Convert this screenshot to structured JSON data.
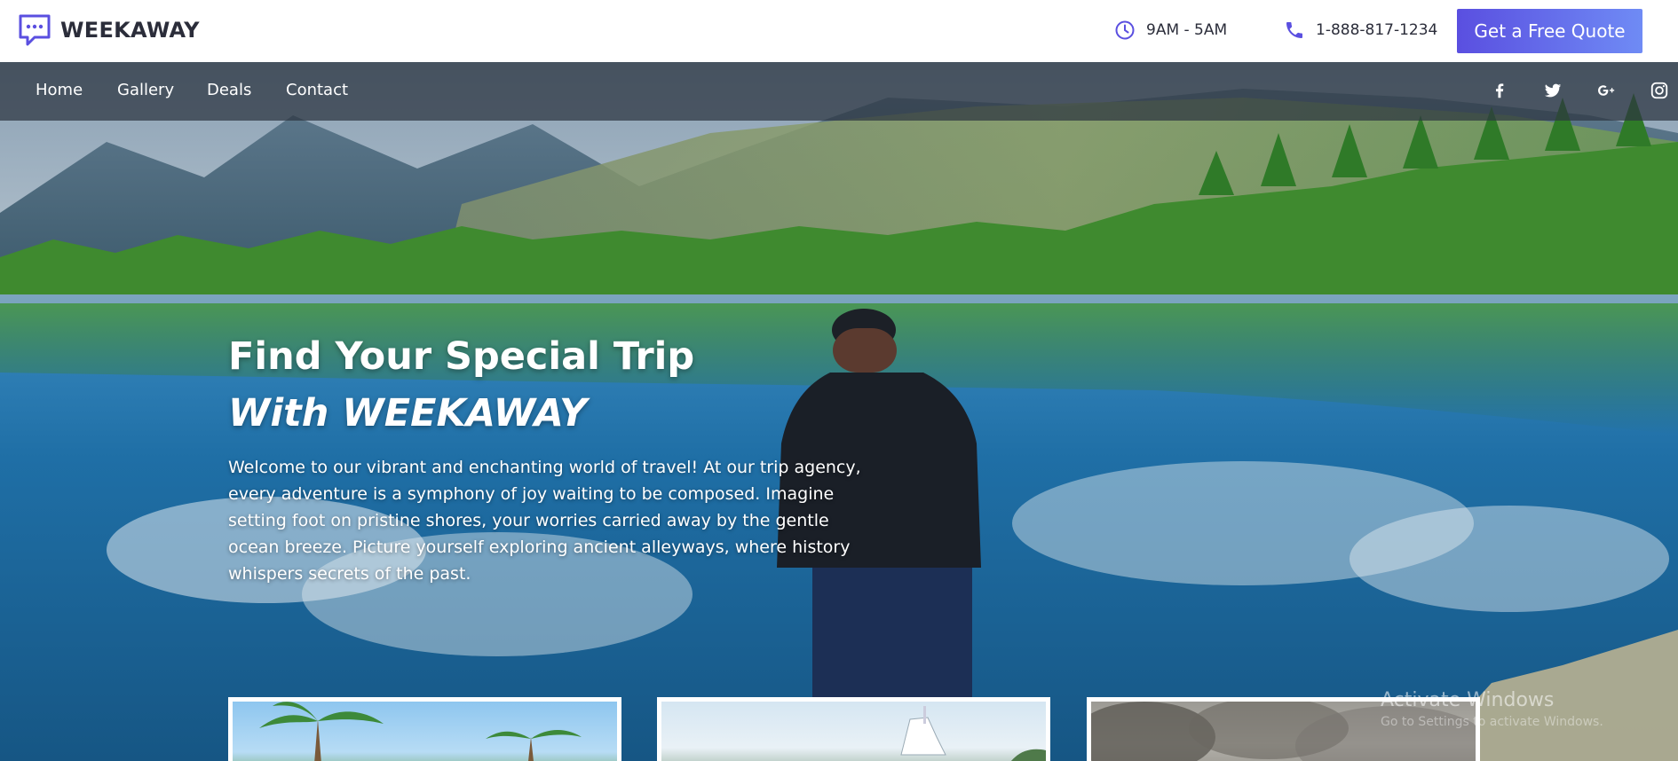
{
  "brand": {
    "name": "WEEKAWAY",
    "icon": "chat-bubble-icon"
  },
  "header": {
    "hours": {
      "icon": "clock-icon",
      "text": "9AM - 5AM"
    },
    "phone": {
      "icon": "phone-icon",
      "text": "1-888-817-1234"
    },
    "cta_label": "Get a Free Quote"
  },
  "nav": {
    "items": [
      {
        "label": "Home"
      },
      {
        "label": "Gallery"
      },
      {
        "label": "Deals"
      },
      {
        "label": "Contact"
      }
    ],
    "social": [
      "facebook-icon",
      "twitter-icon",
      "google-plus-icon",
      "instagram-icon"
    ]
  },
  "hero": {
    "title_line1": "Find Your Special Trip",
    "title_line2": "With WEEKAWAY",
    "description": "Welcome to our vibrant and enchanting world of travel! At our trip agency, every adventure is a symphony of joy waiting to be composed. Imagine setting foot on pristine shores, your worries carried away by the gentle ocean breeze. Picture yourself exploring ancient alleyways, where history whispers secrets of the past."
  },
  "cards": [
    {
      "image": "palm-trees-beach"
    },
    {
      "image": "yacht-harbor"
    },
    {
      "image": "smoky-landscape"
    }
  ],
  "watermark": {
    "title": "Activate Windows",
    "subtitle": "Go to Settings to activate Windows."
  },
  "colors": {
    "accent_start": "#5a4fe0",
    "accent_end": "#6f8bf5",
    "text_dark": "#2b2d3a",
    "nav_overlay": "#2d3440"
  }
}
